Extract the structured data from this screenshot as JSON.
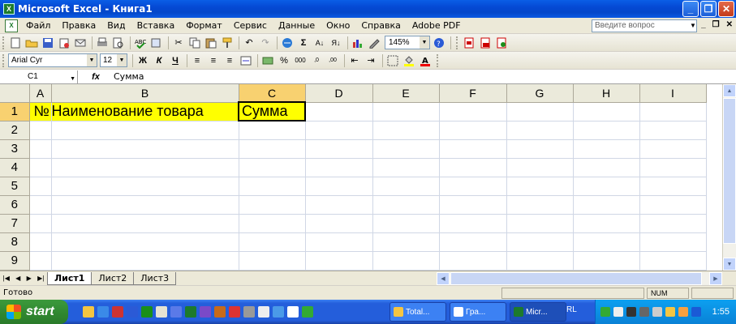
{
  "window": {
    "title": "Microsoft Excel - Книга1",
    "icon": "excel-icon"
  },
  "menu": {
    "items": [
      "Файл",
      "Правка",
      "Вид",
      "Вставка",
      "Формат",
      "Сервис",
      "Данные",
      "Окно",
      "Справка",
      "Adobe PDF"
    ],
    "ask_placeholder": "Введите вопрос"
  },
  "toolbar": {
    "zoom": "145%"
  },
  "format_toolbar": {
    "font": "Arial Cyr",
    "size": "12",
    "bold": "Ж",
    "italic": "К",
    "underline": "Ч"
  },
  "formula_bar": {
    "name_box": "C1",
    "fx": "fx",
    "value": "Сумма"
  },
  "grid": {
    "columns": [
      "A",
      "B",
      "C",
      "D",
      "E",
      "F",
      "G",
      "H",
      "I"
    ],
    "rows": [
      "1",
      "2",
      "3",
      "4",
      "5",
      "6",
      "7",
      "8",
      "9"
    ],
    "cells": {
      "A1": "№",
      "B1": "Наименование товара",
      "C1": "Сумма"
    },
    "fill_color": "#ffff00"
  },
  "sheets": {
    "tabs": [
      "Лист1",
      "Лист2",
      "Лист3"
    ],
    "active": "Лист1"
  },
  "status": {
    "text": "Готово",
    "num": "NUM"
  },
  "taskbar": {
    "start": "start",
    "tasks": [
      "Total...",
      "Гра...",
      "Micr..."
    ],
    "lang": "RL",
    "clock": "1:55"
  }
}
